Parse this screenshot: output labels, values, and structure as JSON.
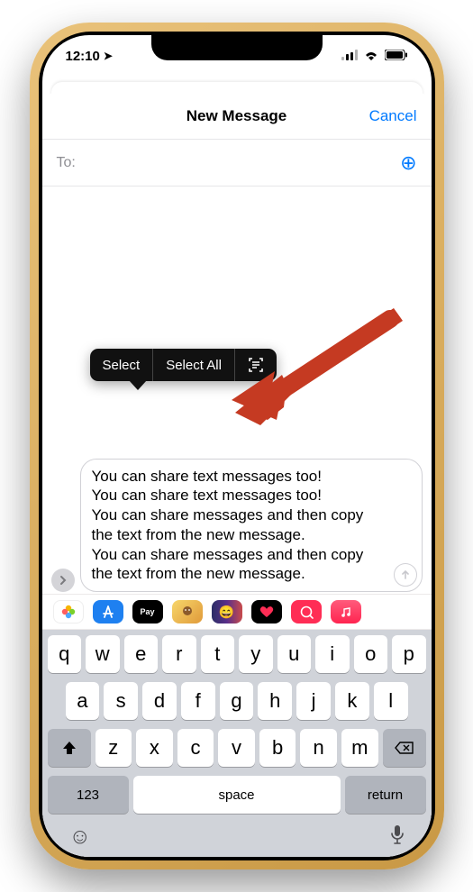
{
  "status": {
    "time": "12:10",
    "location_icon": "➤"
  },
  "sheet": {
    "title": "New Message",
    "cancel": "Cancel"
  },
  "to": {
    "label": "To:"
  },
  "context_menu": {
    "select": "Select",
    "select_all": "Select All"
  },
  "message": {
    "text": "You can share text messages too!\nYou can share text messages too!\nYou can share messages and then copy the text from the new message.\nYou can share messages and then copy the text from the new message."
  },
  "keyboard": {
    "row1": [
      "q",
      "w",
      "e",
      "r",
      "t",
      "y",
      "u",
      "i",
      "o",
      "p"
    ],
    "row2": [
      "a",
      "s",
      "d",
      "f",
      "g",
      "h",
      "j",
      "k",
      "l"
    ],
    "row3": [
      "z",
      "x",
      "c",
      "v",
      "b",
      "n",
      "m"
    ],
    "numbers": "123",
    "space": "space",
    "return": "return"
  }
}
